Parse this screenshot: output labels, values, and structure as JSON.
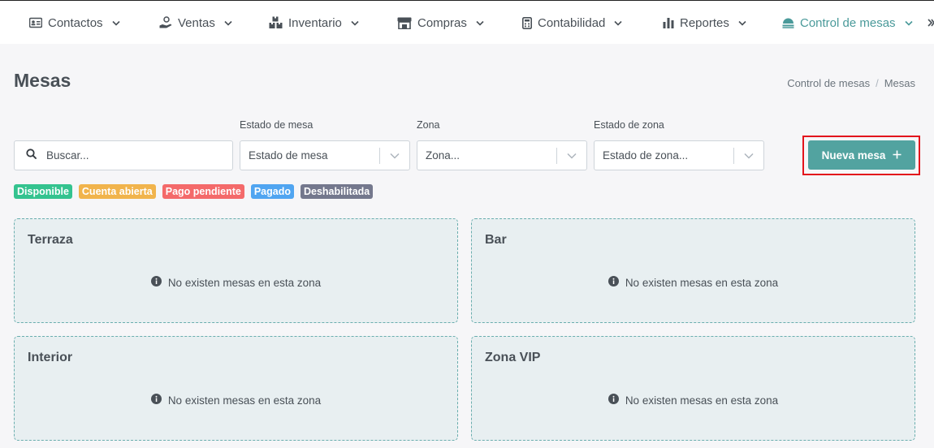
{
  "nav": {
    "items": [
      {
        "label": "Contactos",
        "icon": "contact-card-icon"
      },
      {
        "label": "Ventas",
        "icon": "hand-money-icon"
      },
      {
        "label": "Inventario",
        "icon": "boxes-icon"
      },
      {
        "label": "Compras",
        "icon": "store-icon"
      },
      {
        "label": "Contabilidad",
        "icon": "calculator-icon"
      },
      {
        "label": "Reportes",
        "icon": "bar-chart-icon"
      },
      {
        "label": "Control de mesas",
        "icon": "dish-icon",
        "active": true
      }
    ],
    "active_color": "#4a9a9a"
  },
  "page": {
    "title": "Mesas",
    "breadcrumb": [
      "Control de mesas",
      "Mesas"
    ]
  },
  "filters": {
    "search_placeholder": "Buscar...",
    "estado_mesa_label": "Estado de mesa",
    "estado_mesa_value": "Estado de mesa",
    "zona_label": "Zona",
    "zona_value": "Zona...",
    "estado_zona_label": "Estado de zona",
    "estado_zona_value": "Estado de zona..."
  },
  "actions": {
    "new_table_label": "Nueva mesa",
    "button_color": "#52a3a0"
  },
  "legend": [
    {
      "label": "Disponible",
      "color": "#34c38f"
    },
    {
      "label": "Cuenta abierta",
      "color": "#f1b44c"
    },
    {
      "label": "Pago pendiente",
      "color": "#f46a6a"
    },
    {
      "label": "Pagado",
      "color": "#50a5f1"
    },
    {
      "label": "Deshabilitada",
      "color": "#74788d"
    }
  ],
  "zones": [
    {
      "name": "Terraza",
      "empty_message": "No existen mesas en esta zona"
    },
    {
      "name": "Bar",
      "empty_message": "No existen mesas en esta zona"
    },
    {
      "name": "Interior",
      "empty_message": "No existen mesas en esta zona"
    },
    {
      "name": "Zona VIP",
      "empty_message": "No existen mesas en esta zona"
    }
  ]
}
